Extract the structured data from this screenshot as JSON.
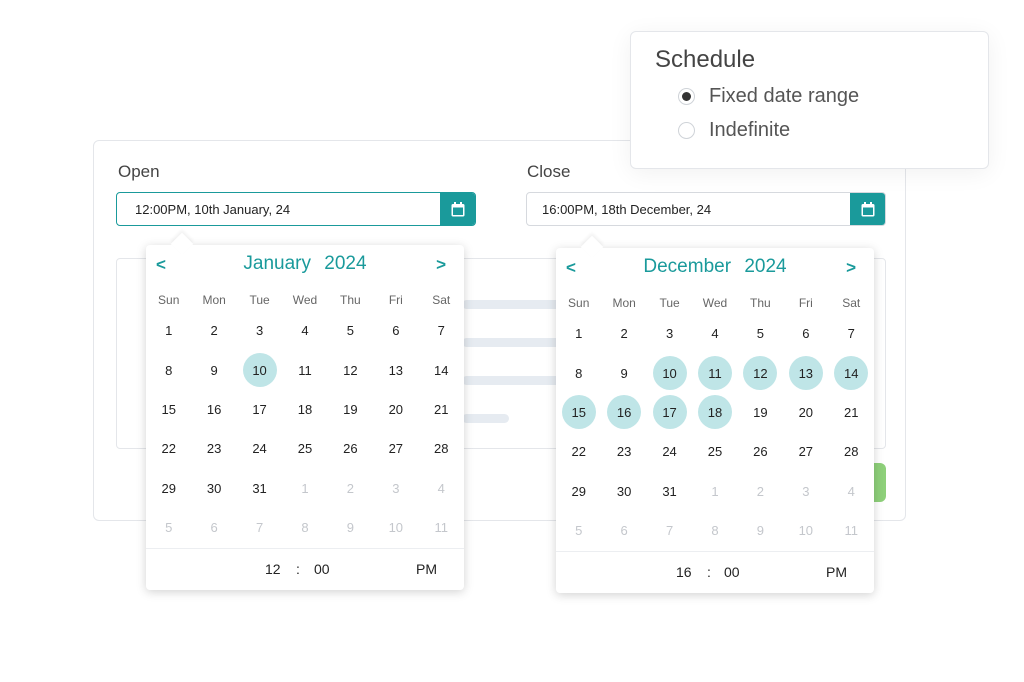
{
  "open": {
    "label": "Open",
    "value": "12:00PM, 10th January, 24",
    "calendar": {
      "month": "January",
      "year": "2024",
      "prev": "<",
      "next": ">",
      "weekdays": [
        "Sun",
        "Mon",
        "Tue",
        "Wed",
        "Thu",
        "Fri",
        "Sat"
      ],
      "weeks": [
        [
          "1",
          "2",
          "3",
          "4",
          "5",
          "6",
          "7"
        ],
        [
          "8",
          "9",
          "10",
          "11",
          "12",
          "13",
          "14"
        ],
        [
          "15",
          "16",
          "17",
          "18",
          "19",
          "20",
          "21"
        ],
        [
          "22",
          "23",
          "24",
          "25",
          "26",
          "27",
          "28"
        ],
        [
          "29",
          "30",
          "31",
          "1",
          "2",
          "3",
          "4"
        ],
        [
          "5",
          "6",
          "7",
          "8",
          "9",
          "10",
          "11"
        ]
      ],
      "selected_days": [
        "10"
      ],
      "time": {
        "hour": "12",
        "separator": ":",
        "minute": "00",
        "ampm": "PM"
      }
    }
  },
  "close": {
    "label": "Close",
    "value": "16:00PM, 18th December, 24",
    "calendar": {
      "month": "December",
      "year": "2024",
      "prev": "<",
      "next": ">",
      "weekdays": [
        "Sun",
        "Mon",
        "Tue",
        "Wed",
        "Thu",
        "Fri",
        "Sat"
      ],
      "weeks": [
        [
          "1",
          "2",
          "3",
          "4",
          "5",
          "6",
          "7"
        ],
        [
          "8",
          "9",
          "10",
          "11",
          "12",
          "13",
          "14"
        ],
        [
          "15",
          "16",
          "17",
          "18",
          "19",
          "20",
          "21"
        ],
        [
          "22",
          "23",
          "24",
          "25",
          "26",
          "27",
          "28"
        ],
        [
          "29",
          "30",
          "31",
          "1",
          "2",
          "3",
          "4"
        ],
        [
          "5",
          "6",
          "7",
          "8",
          "9",
          "10",
          "11"
        ]
      ],
      "selected_days": [
        "10",
        "11",
        "12",
        "13",
        "14",
        "15",
        "16",
        "17",
        "18"
      ],
      "time": {
        "hour": "16",
        "separator": ":",
        "minute": "00",
        "ampm": "PM"
      }
    }
  },
  "schedule": {
    "title": "Schedule",
    "options": [
      {
        "label": "Fixed date range",
        "checked": true
      },
      {
        "label": "Indefinite",
        "checked": false
      }
    ]
  },
  "colors": {
    "accent": "#1a9a9b",
    "selected_day": "#bfe5e7",
    "action_button": "#8ed07a"
  },
  "icons": {
    "calendar_button": "calendar-icon"
  }
}
